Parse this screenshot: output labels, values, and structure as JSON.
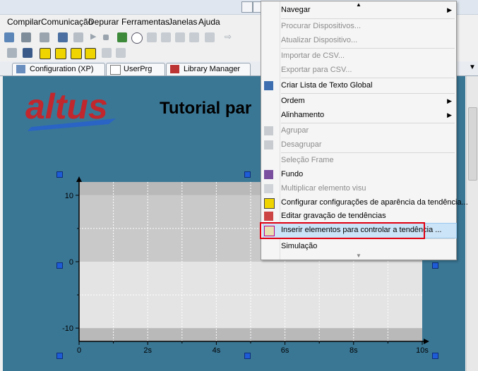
{
  "menubar": {
    "items": [
      "Compilar",
      "Comunicação",
      "Depurar",
      "Ferramentas",
      "Janelas",
      "Ajuda"
    ]
  },
  "tabs": [
    {
      "label": "Configuration (XP)"
    },
    {
      "label": "UserPrg"
    },
    {
      "label": "Library Manager"
    }
  ],
  "canvas": {
    "logo_text": "altus",
    "title_fragment": "Tutorial par"
  },
  "chart_data": {
    "type": "line",
    "title": "",
    "xlabel": "",
    "ylabel": "",
    "x_ticks": [
      "0",
      "2s",
      "4s",
      "6s",
      "8s",
      "10s"
    ],
    "y_ticks": [
      "10",
      "0",
      "-10"
    ],
    "xlim": [
      0,
      10
    ],
    "ylim": [
      -12,
      12
    ],
    "series": [],
    "grid": true
  },
  "context_menu": {
    "items": [
      {
        "label": "Navegar",
        "enabled": true,
        "submenu": true
      },
      {
        "label": "Procurar Dispositivos...",
        "enabled": false
      },
      {
        "label": "Atualizar Dispositivo...",
        "enabled": false
      },
      {
        "label": "Importar de CSV...",
        "enabled": false
      },
      {
        "label": "Exportar para CSV...",
        "enabled": false
      },
      {
        "label": "Criar Lista de Texto Global",
        "enabled": true
      },
      {
        "label": "Ordem",
        "enabled": true,
        "submenu": true
      },
      {
        "label": "Alinhamento",
        "enabled": true,
        "submenu": true
      },
      {
        "label": "Agrupar",
        "enabled": false
      },
      {
        "label": "Desagrupar",
        "enabled": false
      },
      {
        "label": "Seleção Frame",
        "enabled": false
      },
      {
        "label": "Fundo",
        "enabled": true
      },
      {
        "label": "Multiplicar elemento visu",
        "enabled": false
      },
      {
        "label": "Configurar configurações de aparência da tendência...",
        "enabled": true
      },
      {
        "label": "Editar gravação de tendências",
        "enabled": true
      },
      {
        "label": "Inserir elementos para controlar a tendência ...",
        "enabled": true,
        "highlighted": true
      },
      {
        "label": "Simulação",
        "enabled": true
      }
    ]
  },
  "colors": {
    "workspace_bg": "#3a7795",
    "highlight": "#cce4f7",
    "callout_red": "#e00010",
    "logo_red": "#c1272d",
    "logo_blue": "#2a64c4"
  }
}
